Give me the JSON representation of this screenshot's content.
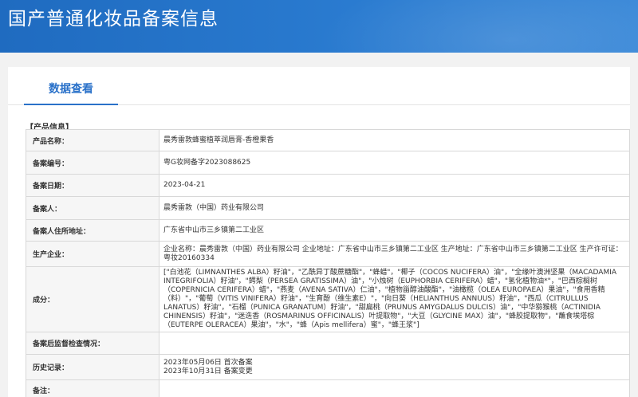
{
  "header": {
    "title": "国产普通化妆品备案信息"
  },
  "tabs": [
    {
      "label": "数据查看"
    }
  ],
  "section": {
    "title": "【产品信息】"
  },
  "rows": [
    {
      "label": "产品名称：",
      "value": "晨秀雷敦蜂蜜植萃润唇膏-香橙果香"
    },
    {
      "label": "备案编号：",
      "value": "粤G妆网备字2023088625"
    },
    {
      "label": "备案日期：",
      "value": "2023-04-21"
    },
    {
      "label": "备案人：",
      "value": "晨秀雷敦（中国）药业有限公司"
    },
    {
      "label": "备案人住所地址：",
      "value": "广东省中山市三乡镇第二工业区"
    },
    {
      "label": "生产企业：",
      "value": "企业名称：晨秀雷敦（中国）药业有限公司 企业地址：广东省中山市三乡镇第二工业区 生产地址：广东省中山市三乡镇第二工业区 生产许可证：粤妆20160334"
    },
    {
      "label": "成分：",
      "value": "[\"白池花（LIMNANTHES ALBA）籽油\"，\"乙酰异丁酸蔗糖酯\"，\"蜂蜡\"，\"椰子（COCOS NUCIFERA）油\"，\"全缘叶澳洲坚果（MACADAMIA INTEGRIFOLIA）籽油\"，\"鳄梨（PERSEA GRATISSIMA）油\"，\"小烛树（EUPHORBIA CERIFERA）蜡\"，\"氢化植物油*\"，\"巴西棕榈树（COPERNICIA CERIFERA）蜡\"，\"燕麦（AVENA SATIVA）仁油\"，\"植物甾醇油酸酯\"，\"油橄榄（OLEA EUROPAEA）果油\"，\"食用香精（料）\"，\"葡萄（VITIS VINIFERA）籽油\"，\"生育酚（维生素E）\"，\"向日葵（HELIANTHUS ANNUUS）籽油\"，\"西瓜（CITRULLUS LANATUS）籽油\"，\"石榴（PUNICA GRANATUM）籽油\"，\"甜扁桃（PRUNUS AMYGDALUS DULCIS）油\"，\"中华猕猴桃（ACTINIDIA CHINENSIS）籽油\"，\"迷迭香（ROSMARINUS OFFICINALIS）叶提取物\"，\"大豆（GLYCINE MAX）油\"，\"蜂胶提取物\"，\"蘸食埃塔棕（EUTERPE OLERACEA）果油\"，\"水\"，\"蜂（Apis mellifera）蜜\"，\"蜂王浆\"]"
    },
    {
      "label": "备案后监督检查情况：",
      "value": ""
    },
    {
      "label": "历史记录：",
      "lines": [
        "2023年05月06日 首次备案",
        "2023年10月31日 备案变更"
      ]
    },
    {
      "label": "备注：",
      "value": ""
    }
  ]
}
